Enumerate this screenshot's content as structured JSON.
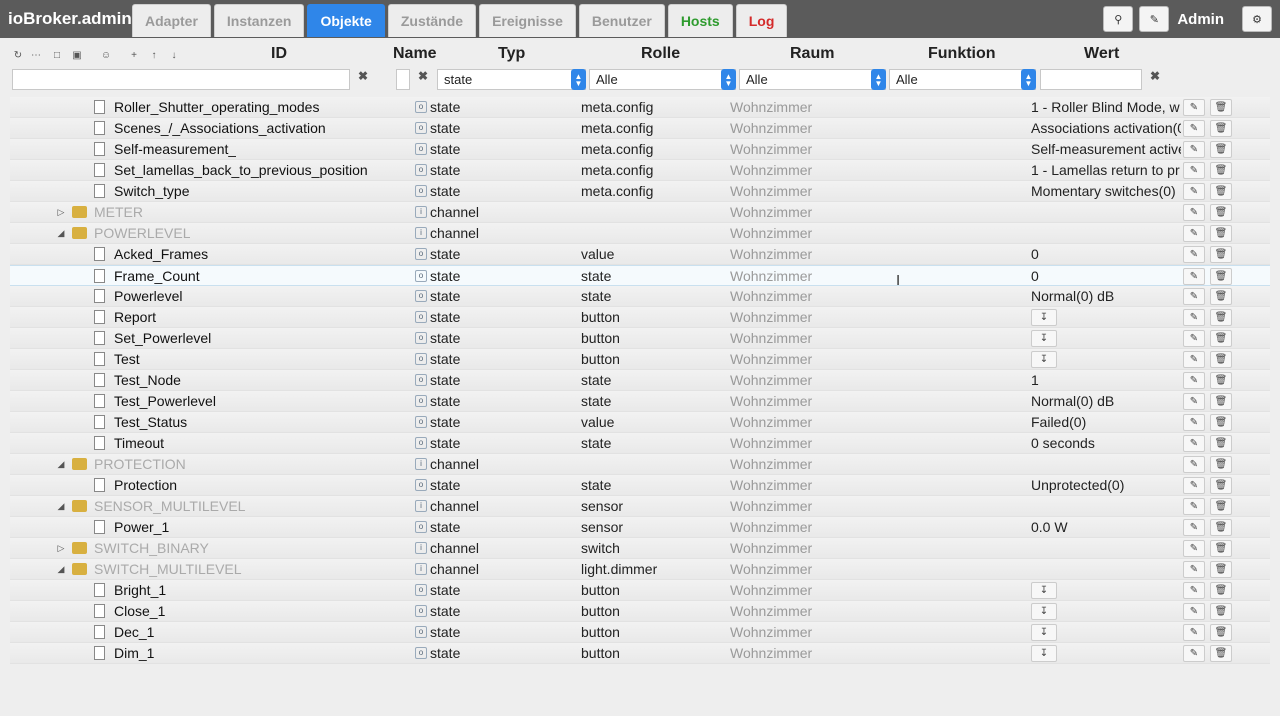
{
  "app": {
    "title": "ioBroker.admin",
    "user": "Admin"
  },
  "tabs": [
    {
      "label": "Adapter",
      "state": ""
    },
    {
      "label": "Instanzen",
      "state": ""
    },
    {
      "label": "Objekte",
      "state": "active"
    },
    {
      "label": "Zustände",
      "state": ""
    },
    {
      "label": "Ereignisse",
      "state": ""
    },
    {
      "label": "Benutzer",
      "state": ""
    },
    {
      "label": "Hosts",
      "state": "green"
    },
    {
      "label": "Log",
      "state": "red"
    }
  ],
  "columns": {
    "id": "ID",
    "name": "Name",
    "typ": "Typ",
    "rolle": "Rolle",
    "raum": "Raum",
    "funktion": "Funktion",
    "wert": "Wert"
  },
  "filters": {
    "id": "",
    "name": "",
    "typ": "state",
    "rolle": "Alle",
    "raum": "Alle",
    "funktion": "Alle",
    "wert": ""
  },
  "rows": [
    {
      "level": 2,
      "kind": "state",
      "name": "Roller_Shutter_operating_modes",
      "typ": "state",
      "rolle": "meta.config",
      "raum": "Wohnzimmer",
      "wert": "1 - Roller Blind Mode, w"
    },
    {
      "level": 2,
      "kind": "state",
      "name": "Scenes_/_Associations_activation",
      "typ": "state",
      "rolle": "meta.config",
      "raum": "Wohnzimmer",
      "wert": "Associations activation(0"
    },
    {
      "level": 2,
      "kind": "state",
      "name": "Self-measurement_",
      "typ": "state",
      "rolle": "meta.config",
      "raum": "Wohnzimmer",
      "wert": "Self-measurement active"
    },
    {
      "level": 2,
      "kind": "state",
      "name": "Set_lamellas_back_to_previous_position",
      "typ": "state",
      "rolle": "meta.config",
      "raum": "Wohnzimmer",
      "wert": "1 - Lamellas return to pr"
    },
    {
      "level": 2,
      "kind": "state",
      "name": "Switch_type",
      "typ": "state",
      "rolle": "meta.config",
      "raum": "Wohnzimmer",
      "wert": "Momentary switches(0)"
    },
    {
      "level": 1,
      "kind": "channel",
      "toggle": "collapsed",
      "name": "METER",
      "typ": "channel",
      "rolle": "",
      "raum": "Wohnzimmer",
      "wert": ""
    },
    {
      "level": 1,
      "kind": "channel",
      "toggle": "expanded",
      "name": "POWERLEVEL",
      "typ": "channel",
      "rolle": "",
      "raum": "Wohnzimmer",
      "wert": ""
    },
    {
      "level": 2,
      "kind": "state",
      "name": "Acked_Frames",
      "typ": "state",
      "rolle": "value",
      "raum": "Wohnzimmer",
      "wert": "0"
    },
    {
      "level": 2,
      "kind": "state",
      "name": "Frame_Count",
      "typ": "state",
      "rolle": "state",
      "raum": "Wohnzimmer",
      "wert": "0",
      "highlight": true
    },
    {
      "level": 2,
      "kind": "state",
      "name": "Powerlevel",
      "typ": "state",
      "rolle": "state",
      "raum": "Wohnzimmer",
      "wert": "Normal(0) dB"
    },
    {
      "level": 2,
      "kind": "state",
      "name": "Report",
      "typ": "state",
      "rolle": "button",
      "raum": "Wohnzimmer",
      "wert": "",
      "button": true
    },
    {
      "level": 2,
      "kind": "state",
      "name": "Set_Powerlevel",
      "typ": "state",
      "rolle": "button",
      "raum": "Wohnzimmer",
      "wert": "",
      "button": true
    },
    {
      "level": 2,
      "kind": "state",
      "name": "Test",
      "typ": "state",
      "rolle": "button",
      "raum": "Wohnzimmer",
      "wert": "",
      "button": true
    },
    {
      "level": 2,
      "kind": "state",
      "name": "Test_Node",
      "typ": "state",
      "rolle": "state",
      "raum": "Wohnzimmer",
      "wert": "1"
    },
    {
      "level": 2,
      "kind": "state",
      "name": "Test_Powerlevel",
      "typ": "state",
      "rolle": "state",
      "raum": "Wohnzimmer",
      "wert": "Normal(0) dB"
    },
    {
      "level": 2,
      "kind": "state",
      "name": "Test_Status",
      "typ": "state",
      "rolle": "value",
      "raum": "Wohnzimmer",
      "wert": "Failed(0)"
    },
    {
      "level": 2,
      "kind": "state",
      "name": "Timeout",
      "typ": "state",
      "rolle": "state",
      "raum": "Wohnzimmer",
      "wert": "0 seconds"
    },
    {
      "level": 1,
      "kind": "channel",
      "toggle": "expanded",
      "name": "PROTECTION",
      "typ": "channel",
      "rolle": "",
      "raum": "Wohnzimmer",
      "wert": ""
    },
    {
      "level": 2,
      "kind": "state",
      "name": "Protection",
      "typ": "state",
      "rolle": "state",
      "raum": "Wohnzimmer",
      "wert": "Unprotected(0)"
    },
    {
      "level": 1,
      "kind": "channel",
      "toggle": "expanded",
      "name": "SENSOR_MULTILEVEL",
      "typ": "channel",
      "rolle": "sensor",
      "raum": "Wohnzimmer",
      "wert": ""
    },
    {
      "level": 2,
      "kind": "state",
      "name": "Power_1",
      "typ": "state",
      "rolle": "sensor",
      "raum": "Wohnzimmer",
      "wert": "0.0 W"
    },
    {
      "level": 1,
      "kind": "channel",
      "toggle": "collapsed",
      "name": "SWITCH_BINARY",
      "typ": "channel",
      "rolle": "switch",
      "raum": "Wohnzimmer",
      "wert": ""
    },
    {
      "level": 1,
      "kind": "channel",
      "toggle": "expanded",
      "name": "SWITCH_MULTILEVEL",
      "typ": "channel",
      "rolle": "light.dimmer",
      "raum": "Wohnzimmer",
      "wert": ""
    },
    {
      "level": 2,
      "kind": "state",
      "name": "Bright_1",
      "typ": "state",
      "rolle": "button",
      "raum": "Wohnzimmer",
      "wert": "",
      "button": true
    },
    {
      "level": 2,
      "kind": "state",
      "name": "Close_1",
      "typ": "state",
      "rolle": "button",
      "raum": "Wohnzimmer",
      "wert": "",
      "button": true
    },
    {
      "level": 2,
      "kind": "state",
      "name": "Dec_1",
      "typ": "state",
      "rolle": "button",
      "raum": "Wohnzimmer",
      "wert": "",
      "button": true
    },
    {
      "level": 2,
      "kind": "state",
      "name": "Dim_1",
      "typ": "state",
      "rolle": "button",
      "raum": "Wohnzimmer",
      "wert": "",
      "button": true
    }
  ]
}
